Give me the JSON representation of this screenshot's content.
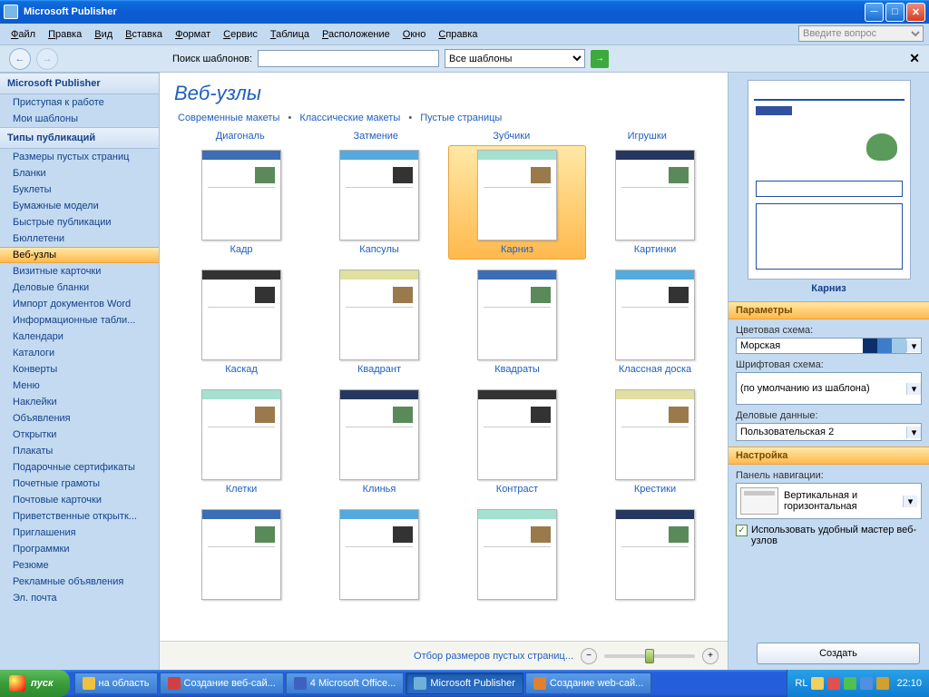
{
  "window": {
    "title": "Microsoft Publisher"
  },
  "menu": [
    "Файл",
    "Правка",
    "Вид",
    "Вставка",
    "Формат",
    "Сервис",
    "Таблица",
    "Расположение",
    "Окно",
    "Справка"
  ],
  "help_placeholder": "Введите вопрос",
  "nav": {
    "search_label": "Поиск шаблонов:",
    "filter": "Все шаблоны"
  },
  "sidebar": {
    "header1": "Microsoft Publisher",
    "group1": [
      "Приступая к работе",
      "Мои шаблоны"
    ],
    "header2": "Типы публикаций",
    "group2": [
      "Размеры пустых страниц",
      "Бланки",
      "Буклеты",
      "Бумажные модели",
      "Быстрые публикации",
      "Бюллетени",
      "Веб-узлы",
      "Визитные карточки",
      "Деловые бланки",
      "Импорт документов Word",
      "Информационные табли...",
      "Календари",
      "Каталоги",
      "Конверты",
      "Меню",
      "Наклейки",
      "Объявления",
      "Открытки",
      "Плакаты",
      "Подарочные сертификаты",
      "Почетные грамоты",
      "Почтовые карточки",
      "Приветственные открытк...",
      "Приглашения",
      "Программки",
      "Резюме",
      "Рекламные объявления",
      "Эл. почта"
    ],
    "selected_index": 6
  },
  "gallery": {
    "title": "Веб-узлы",
    "tabs": [
      "Современные макеты",
      "Классические макеты",
      "Пустые страницы"
    ],
    "headrow": [
      "Диагональ",
      "Затмение",
      "Зубчики",
      "Игрушки"
    ],
    "rows": [
      [
        "Кадр",
        "Капсулы",
        "Карниз",
        "Картинки"
      ],
      [
        "Каскад",
        "Квадрант",
        "Квадраты",
        "Классная доска"
      ],
      [
        "Клетки",
        "Клинья",
        "Контраст",
        "Крестики"
      ],
      [
        "",
        "",
        "",
        ""
      ]
    ],
    "selected": {
      "row": 0,
      "col": 2
    },
    "bottom_link": "Отбор размеров пустых страниц..."
  },
  "preview": {
    "label": "Карниз"
  },
  "params": {
    "header": "Параметры",
    "color_label": "Цветовая схема:",
    "color_value": "Морская",
    "color_swatches": [
      "#0b2f6b",
      "#3c7cc8",
      "#a0cae8"
    ],
    "font_label": "Шрифтовая схема:",
    "font_value": "(по умолчанию из шаблона)",
    "biz_label": "Деловые данные:",
    "biz_value": "Пользовательская 2"
  },
  "custom": {
    "header": "Настройка",
    "nav_label": "Панель навигации:",
    "nav_value": "Вертикальная и горизонтальная",
    "wizard_check": "Использовать удобный мастер веб-узлов"
  },
  "create_btn": "Создать",
  "taskbar": {
    "start": "пуск",
    "buttons": [
      "на область",
      "Создание веб-сай...",
      "4 Microsoft Office...",
      "Microsoft Publisher",
      "Создание web-сай..."
    ],
    "active_index": 3,
    "lang": "RL",
    "clock": "22:10"
  }
}
